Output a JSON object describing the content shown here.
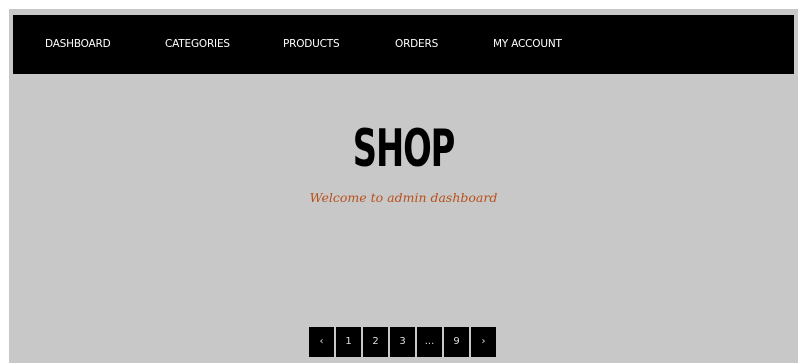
{
  "nav": {
    "items": [
      {
        "label": "DASHBOARD"
      },
      {
        "label": "CATEGORIES"
      },
      {
        "label": "PRODUCTS"
      },
      {
        "label": "ORDERS"
      },
      {
        "label": "MY ACCOUNT"
      }
    ]
  },
  "hero": {
    "title": "SHOP",
    "subtitle": "Welcome to admin dashboard"
  },
  "pagination": {
    "prev_label": "‹",
    "pages": [
      "1",
      "2",
      "3",
      "...",
      "9"
    ],
    "next_label": "›"
  },
  "colors": {
    "nav_background": "#000000",
    "page_background": "#c8c8c8",
    "subtitle": "#b8501c"
  }
}
